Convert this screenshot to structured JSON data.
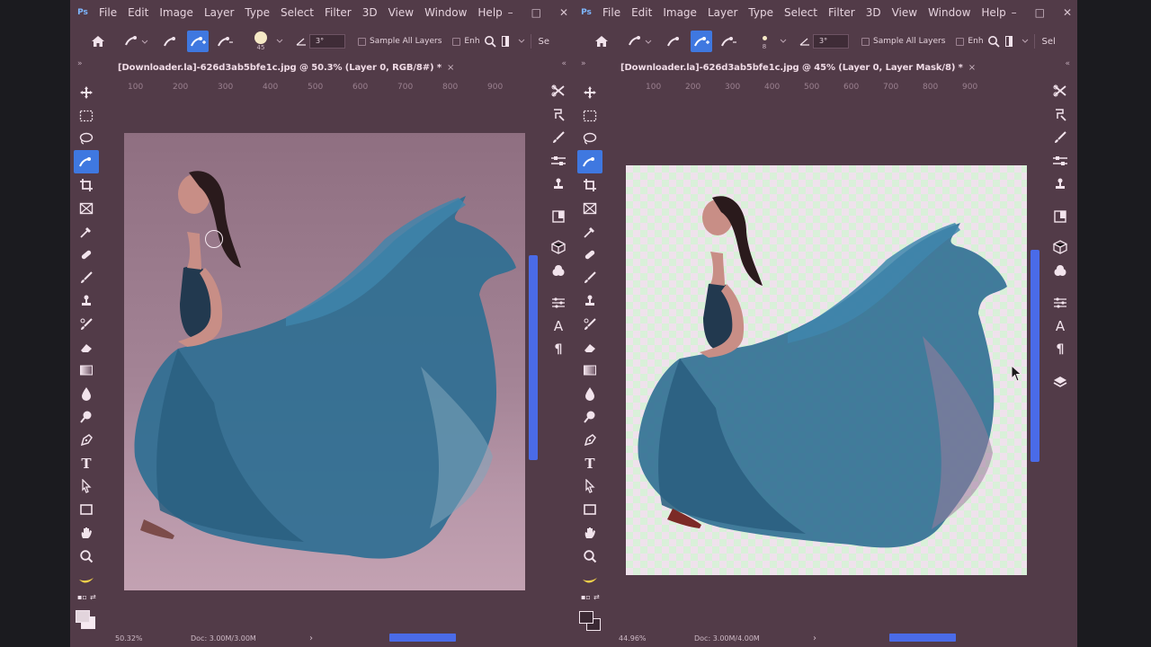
{
  "app": {
    "logo": "Ps"
  },
  "menu": [
    "File",
    "Edit",
    "Image",
    "Layer",
    "Type",
    "Select",
    "Filter",
    "3D",
    "View",
    "Window",
    "Help"
  ],
  "window_controls": {
    "minimize": "–",
    "maximize": "□",
    "close": "✕"
  },
  "left": {
    "tab_title": "[Downloader.la]-626d3ab5bfe1c.jpg @ 50.3% (Layer 0, RGB/8#) *",
    "tab_close": "×",
    "brush_size": "45",
    "angle": "3°",
    "sample_all_layers": "Sample All Layers",
    "enhance": "Enh",
    "select_cut": "Se",
    "ruler_h": [
      "100",
      "200",
      "300",
      "400",
      "500",
      "600",
      "700",
      "800",
      "900"
    ],
    "status": {
      "zoom": "50.32%",
      "doc": "Doc: 3.00M/3.00M",
      "arrow": "›"
    },
    "panel_chevrons": "»",
    "panel_chevrons_right": "«"
  },
  "right": {
    "tab_title": "[Downloader.la]-626d3ab5bfe1c.jpg @ 45% (Layer 0, Layer Mask/8) *",
    "tab_close": "×",
    "brush_size": "8",
    "angle": "3°",
    "sample_all_layers": "Sample All Layers",
    "enhance": "Enh",
    "select_cut": "Sel",
    "ruler_h": [
      "100",
      "200",
      "300",
      "400",
      "500",
      "600",
      "700",
      "800",
      "900"
    ],
    "status": {
      "zoom": "44.96%",
      "doc": "Doc: 3.00M/4.00M",
      "arrow": "›"
    },
    "panel_chevrons": "»",
    "panel_chevrons_right": "«"
  },
  "tools": [
    "move-tool",
    "marquee-tool",
    "lasso-tool",
    "quick-selection-tool",
    "crop-tool",
    "frame-tool",
    "eyedropper-tool",
    "healing-brush-tool",
    "brush-tool",
    "clone-stamp-tool",
    "history-brush-tool",
    "eraser-tool",
    "gradient-tool",
    "blur-tool",
    "dodge-tool",
    "pen-tool",
    "type-tool",
    "path-selection-tool",
    "rectangle-tool",
    "hand-tool",
    "zoom-tool",
    "edit-toolbar"
  ],
  "type_tool_glyph": "T",
  "panel_glyphs": {
    "character": "A",
    "paragraph": "¶"
  },
  "swap_glyph": "⇄",
  "colors": {
    "accent": "#3f78e0",
    "panel_bg": "#523b48",
    "scrollbar": "#4a6be8",
    "dress": "#2f6f92"
  }
}
